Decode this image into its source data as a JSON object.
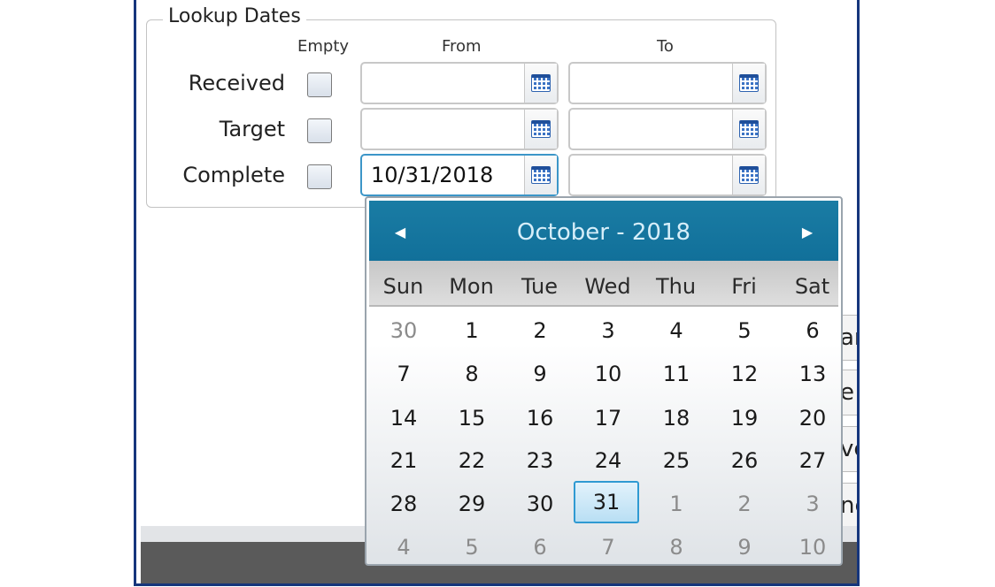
{
  "lookup": {
    "legend": "Lookup Dates",
    "columns": {
      "empty": "Empty",
      "from": "From",
      "to": "To"
    },
    "rows": [
      {
        "label": "Received",
        "from": "",
        "to": ""
      },
      {
        "label": "Target",
        "from": "",
        "to": ""
      },
      {
        "label": "Complete",
        "from": "10/31/2018",
        "to": ""
      }
    ]
  },
  "calendar": {
    "title": "October - 2018",
    "days_of_week": [
      "Sun",
      "Mon",
      "Tue",
      "Wed",
      "Thu",
      "Fri",
      "Sat"
    ],
    "weeks": [
      [
        "30",
        "1",
        "2",
        "3",
        "4",
        "5",
        "6"
      ],
      [
        "7",
        "8",
        "9",
        "10",
        "11",
        "12",
        "13"
      ],
      [
        "14",
        "15",
        "16",
        "17",
        "18",
        "19",
        "20"
      ],
      [
        "21",
        "22",
        "23",
        "24",
        "25",
        "26",
        "27"
      ],
      [
        "28",
        "29",
        "30",
        "31",
        "1",
        "2",
        "3"
      ],
      [
        "4",
        "5",
        "6",
        "7",
        "8",
        "9",
        "10"
      ]
    ],
    "selected_day": "31"
  },
  "background_buttons": [
    "ar",
    "e",
    "ve",
    "ne"
  ],
  "colors": {
    "header": "#1477a0",
    "selected_border": "#2f9ad2",
    "frame": "#16367c"
  }
}
